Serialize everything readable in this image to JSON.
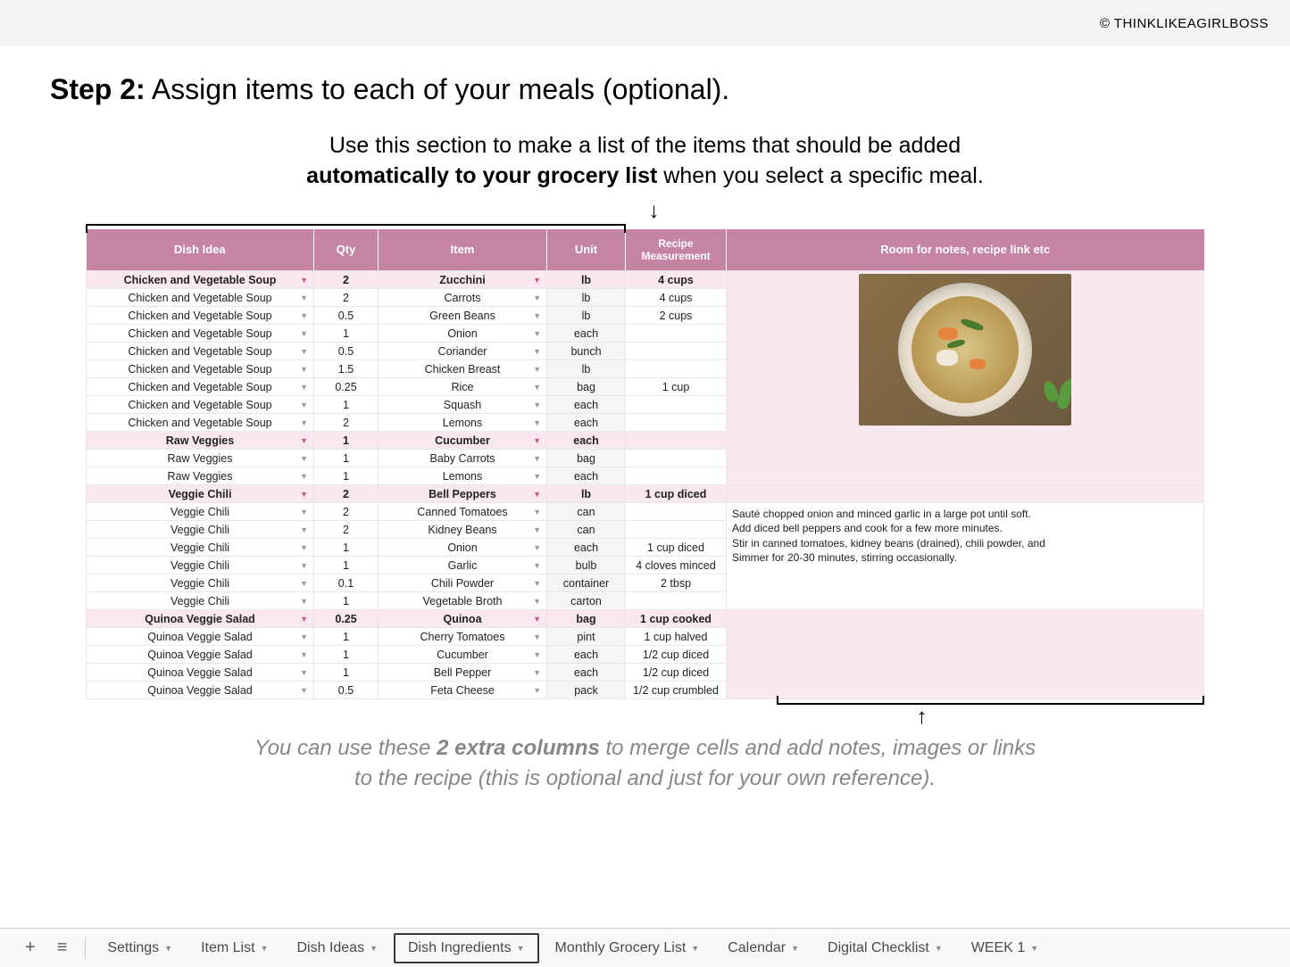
{
  "copyright": "© THINKLIKEAGIRLBOSS",
  "step_label": "Step 2:",
  "step_title": "Assign items to each of your meals (optional).",
  "instruction_pre": "Use this section to make a list of the items that should be added",
  "instruction_bold": "automatically to your grocery list",
  "instruction_post": "when you select a specific meal.",
  "headers": {
    "dish": "Dish Idea",
    "qty": "Qty",
    "item": "Item",
    "unit": "Unit",
    "recipe": "Recipe Measurement",
    "notes": "Room for notes, recipe link etc"
  },
  "rows": [
    {
      "dish": "Chicken and Vegetable Soup",
      "qty": "2",
      "item": "Zucchini",
      "unit": "lb",
      "recipe": "4 cups",
      "hl": true
    },
    {
      "dish": "Chicken and Vegetable Soup",
      "qty": "2",
      "item": "Carrots",
      "unit": "lb",
      "recipe": "4 cups"
    },
    {
      "dish": "Chicken and Vegetable Soup",
      "qty": "0.5",
      "item": "Green Beans",
      "unit": "lb",
      "recipe": "2 cups"
    },
    {
      "dish": "Chicken and Vegetable Soup",
      "qty": "1",
      "item": "Onion",
      "unit": "each",
      "recipe": ""
    },
    {
      "dish": "Chicken and Vegetable Soup",
      "qty": "0.5",
      "item": "Coriander",
      "unit": "bunch",
      "recipe": ""
    },
    {
      "dish": "Chicken and Vegetable Soup",
      "qty": "1.5",
      "item": "Chicken Breast",
      "unit": "lb",
      "recipe": ""
    },
    {
      "dish": "Chicken and Vegetable Soup",
      "qty": "0.25",
      "item": "Rice",
      "unit": "bag",
      "recipe": "1 cup"
    },
    {
      "dish": "Chicken and Vegetable Soup",
      "qty": "1",
      "item": "Squash",
      "unit": "each",
      "recipe": ""
    },
    {
      "dish": "Chicken and Vegetable Soup",
      "qty": "2",
      "item": "Lemons",
      "unit": "each",
      "recipe": ""
    },
    {
      "dish": "Raw Veggies",
      "qty": "1",
      "item": "Cucumber",
      "unit": "each",
      "recipe": "",
      "hl": true
    },
    {
      "dish": "Raw Veggies",
      "qty": "1",
      "item": "Baby Carrots",
      "unit": "bag",
      "recipe": ""
    },
    {
      "dish": "Raw Veggies",
      "qty": "1",
      "item": "Lemons",
      "unit": "each",
      "recipe": ""
    },
    {
      "dish": "Veggie Chili",
      "qty": "2",
      "item": "Bell Peppers",
      "unit": "lb",
      "recipe": "1 cup diced",
      "hl": true
    },
    {
      "dish": "Veggie Chili",
      "qty": "2",
      "item": "Canned Tomatoes",
      "unit": "can",
      "recipe": ""
    },
    {
      "dish": "Veggie Chili",
      "qty": "2",
      "item": "Kidney Beans",
      "unit": "can",
      "recipe": ""
    },
    {
      "dish": "Veggie Chili",
      "qty": "1",
      "item": "Onion",
      "unit": "each",
      "recipe": "1 cup diced"
    },
    {
      "dish": "Veggie Chili",
      "qty": "1",
      "item": "Garlic",
      "unit": "bulb",
      "recipe": "4 cloves minced"
    },
    {
      "dish": "Veggie Chili",
      "qty": "0.1",
      "item": "Chili Powder",
      "unit": "container",
      "recipe": "2 tbsp"
    },
    {
      "dish": "Veggie Chili",
      "qty": "1",
      "item": "Vegetable Broth",
      "unit": "carton",
      "recipe": ""
    },
    {
      "dish": "Quinoa Veggie Salad",
      "qty": "0.25",
      "item": "Quinoa",
      "unit": "bag",
      "recipe": "1 cup cooked",
      "hl": true
    },
    {
      "dish": "Quinoa Veggie Salad",
      "qty": "1",
      "item": "Cherry Tomatoes",
      "unit": "pint",
      "recipe": "1 cup halved"
    },
    {
      "dish": "Quinoa Veggie Salad",
      "qty": "1",
      "item": "Cucumber",
      "unit": "each",
      "recipe": "1/2 cup diced"
    },
    {
      "dish": "Quinoa Veggie Salad",
      "qty": "1",
      "item": "Bell Pepper",
      "unit": "each",
      "recipe": "1/2 cup diced"
    },
    {
      "dish": "Quinoa Veggie Salad",
      "qty": "0.5",
      "item": "Feta Cheese",
      "unit": "pack",
      "recipe": "1/2 cup crumbled"
    }
  ],
  "recipe_lines": [
    "Sauté chopped onion and minced garlic in a large pot until soft.",
    "Add diced bell peppers and cook for a few more minutes.",
    "Stir in canned tomatoes, kidney beans (drained), chili powder, and",
    "Simmer for 20-30 minutes, stirring occasionally."
  ],
  "footer_pre": "You can use these ",
  "footer_bold": "2 extra columns",
  "footer_mid": " to merge cells and add notes, images or links",
  "footer_post": "to the recipe (this is optional and just for your own reference).",
  "tabs": [
    {
      "label": "Settings"
    },
    {
      "label": "Item List"
    },
    {
      "label": "Dish Ideas"
    },
    {
      "label": "Dish Ingredients",
      "active": true
    },
    {
      "label": "Monthly Grocery List"
    },
    {
      "label": "Calendar"
    },
    {
      "label": "Digital Checklist"
    },
    {
      "label": "WEEK 1"
    }
  ]
}
